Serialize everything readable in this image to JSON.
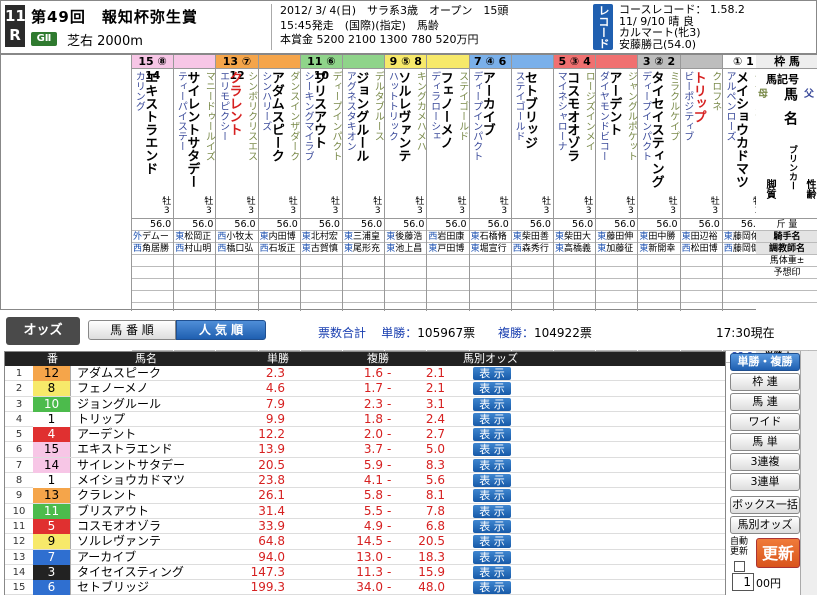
{
  "header": {
    "race_no": "11",
    "race_unit": "R",
    "title": "第49回　報知杯弥生賞",
    "grade": "GⅡ",
    "course": "芝右 2000m",
    "info_line1": "2012/ 3/ 4(日)　サラ系3歳　オープン　15頭",
    "info_line2": "15:45発走　(国際)(指定)　馬齢",
    "info_line3": "本賞金 5200 2100 1300 780 520万円",
    "record_tag": "レコード",
    "record_line1": "コースレコード： 1.58.2",
    "record_line2": "11/ 9/10 晴 良",
    "record_line3": "カルマート(牝3)",
    "record_line4": "安藤勝己(54.0)"
  },
  "card_labels": {
    "waku": "枠 馬",
    "ukigo": "馬記号",
    "bamei": "馬名",
    "haha": "母",
    "chichi": "父",
    "blinker": "ブリンカー",
    "kyakushitsu": "脚質",
    "seirei": "性齢",
    "kinryo": "斤 量",
    "jockey": "騎手名",
    "trainer": "調教師名",
    "weight": "馬体重±",
    "yoso": "予想印",
    "dm": "対戦型DM",
    "odds": "単勝オッズ"
  },
  "horses": [
    {
      "gate": "15 ⑧ 14",
      "gcolor": "#f7c6e6",
      "name": "エキストラエンド",
      "red": false,
      "sire": "カリング",
      "dam": "",
      "sex": "牡3",
      "kin": "56.0",
      "jockey_pref": "外",
      "jockey": "デムー",
      "trainer_pref": "西",
      "trainer": "角居勝",
      "dm": "67.6",
      "dmbg": "#f5d6a0",
      "odds": "13.9"
    },
    {
      "gate": "",
      "gcolor": "#f7c6e6",
      "name": "サイレントサタデー",
      "red": false,
      "sire": "ティーパイステー",
      "dam": "マニードゥールイズ",
      "sex": "牡3",
      "kin": "56.0",
      "jockey_pref": "東",
      "jockey": "松岡正",
      "trainer_pref": "西",
      "trainer": "村山明",
      "dm": "50.4",
      "dmbg": "#fff",
      "odds": "20.5"
    },
    {
      "gate": "13 ⑦ 12",
      "gcolor": "#f5a54a",
      "name": "クラレント",
      "red": true,
      "sire": "エリモピクシー",
      "dam": "シンボリクリスエス",
      "sex": "牡3",
      "kin": "56.0",
      "jockey_pref": "西",
      "jockey": "小牧太",
      "trainer_pref": "西",
      "trainer": "橋口弘",
      "dm": "65.4",
      "dmbg": "#bfe8a8",
      "odds": "26.1"
    },
    {
      "gate": "",
      "gcolor": "#f5a54a",
      "name": "アダムスピーク",
      "red": false,
      "sire": "シンハリーズ",
      "dam": "ダンスインザダーク",
      "sex": "牡3",
      "kin": "56.0",
      "jockey_pref": "東",
      "jockey": "内田博",
      "trainer_pref": "西",
      "trainer": "石坂正",
      "dm": "63.9",
      "dmbg": "#e6a8e6",
      "odds": "2.3"
    },
    {
      "gate": "11 ⑥ 10",
      "gcolor": "#8fd48a",
      "name": "ブリスアウト",
      "red": false,
      "sire": "シーキングマイラブ",
      "dam": "ディープインパクト",
      "sex": "牡3",
      "kin": "56.0",
      "jockey_pref": "東",
      "jockey": "北村宏",
      "trainer_pref": "東",
      "trainer": "古賀慎",
      "dm": "34.7",
      "dmbg": "#fff",
      "odds": "31.4"
    },
    {
      "gate": "",
      "gcolor": "#8fd48a",
      "name": "ジョングルール",
      "red": false,
      "sire": "アグネスタキオン",
      "dam": "デルタブルース",
      "sex": "牡3",
      "kin": "56.0",
      "jockey_pref": "東",
      "jockey": "三浦皇",
      "trainer_pref": "東",
      "trainer": "尾形充",
      "dm": "63.8",
      "dmbg": "#fff",
      "odds": "7.9"
    },
    {
      "gate": "9 ⑤ 8",
      "gcolor": "#f7e96a",
      "name": "ソルレヴァンテ",
      "red": false,
      "sire": "ハットトリック",
      "dam": "キングカメハメハ",
      "sex": "牡3",
      "kin": "56.0",
      "jockey_pref": "東",
      "jockey": "後藤浩",
      "trainer_pref": "東",
      "trainer": "池上昌",
      "dm": "17.7",
      "dmbg": "#fff",
      "odds": "64.8"
    },
    {
      "gate": "",
      "gcolor": "#f7e96a",
      "name": "フェノーメノ",
      "red": false,
      "sire": "ディラローシェ",
      "dam": "ステイゴールド",
      "sex": "牡3",
      "kin": "56.0",
      "jockey_pref": "西",
      "jockey": "岩田康",
      "trainer_pref": "東",
      "trainer": "戸田博",
      "dm": "62.2",
      "dmbg": "#fff",
      "odds": "4.6"
    },
    {
      "gate": "7 ④ 6",
      "gcolor": "#7ab0ea",
      "name": "アーカイブ",
      "red": false,
      "sire": "ディープインパクト",
      "dam": "",
      "sex": "牡3",
      "kin": "56.0",
      "jockey_pref": "東",
      "jockey": "石橋脩",
      "trainer_pref": "東",
      "trainer": "堀宣行",
      "dm": "54.2",
      "dmbg": "#fff",
      "odds": "94.0"
    },
    {
      "gate": "",
      "gcolor": "#7ab0ea",
      "name": "セトブリッジ",
      "red": false,
      "sire": "ステイゴールド",
      "dam": "",
      "sex": "牡3",
      "kin": "56.0",
      "jockey_pref": "東",
      "jockey": "柴田善",
      "trainer_pref": "西",
      "trainer": "森秀行",
      "dm": "21.9",
      "dmbg": "#fff",
      "odds": "199.3"
    },
    {
      "gate": "5 ③ 4",
      "gcolor": "#f07070",
      "name": "コスモオオゾラ",
      "red": false,
      "sire": "マイネシャローナ",
      "dam": "ロージズインメイ",
      "sex": "牡3",
      "kin": "56.0",
      "jockey_pref": "東",
      "jockey": "柴田大",
      "trainer_pref": "東",
      "trainer": "高橋義",
      "dm": "41.3",
      "dmbg": "#fff",
      "odds": "33.9"
    },
    {
      "gate": "",
      "gcolor": "#f07070",
      "name": "アーデント",
      "red": false,
      "sire": "ダイヤモンドビコー",
      "dam": "ジャングルポケット",
      "sex": "牡3",
      "kin": "56.0",
      "jockey_pref": "東",
      "jockey": "藤田伸",
      "trainer_pref": "東",
      "trainer": "加藤征",
      "dm": "59.0",
      "dmbg": "#fff",
      "odds": "12.2"
    },
    {
      "gate": "3 ② 2",
      "gcolor": "#bdbdbd",
      "name": "タイセイスティング",
      "red": false,
      "sire": "ディープインパクト",
      "dam": "ミラクルケイプ",
      "sex": "牡3",
      "kin": "56.0",
      "jockey_pref": "東",
      "jockey": "田中勝",
      "trainer_pref": "東",
      "trainer": "新開幸",
      "dm": "",
      "dmbg": "#fff",
      "odds": "147.3"
    },
    {
      "gate": "",
      "gcolor": "#bdbdbd",
      "name": "トリップ",
      "red": true,
      "sire": "ビーポジティブ",
      "dam": "クロフネ",
      "sex": "牡3",
      "kin": "56.0",
      "jockey_pref": "東",
      "jockey": "田辺裕",
      "trainer_pref": "西",
      "trainer": "松田博",
      "dm": "70.2",
      "dmbg": "#f7b7c9",
      "odds": "9.9"
    },
    {
      "gate": "① 1",
      "gcolor": "#fff",
      "name": "メイショウカドマツ",
      "red": false,
      "sire": "アルペンローズ",
      "dam": "ダイワメジャー",
      "sex": "牡3",
      "kin": "56.0",
      "jockey_pref": "東",
      "jockey": "藤岡佑",
      "trainer_pref": "西",
      "trainer": "藤岡健",
      "dm": "51.7",
      "dmbg": "#fff",
      "odds": "23.8"
    }
  ],
  "oddsbar": {
    "title": "オッズ",
    "tab_umaban": "馬 番 順",
    "tab_ninki": "人 気 順",
    "votes_label": "票数合計",
    "win_label": "単勝：",
    "win_votes": "105967票",
    "place_label": "複勝：",
    "place_votes": "104922票",
    "now": "17:30現在"
  },
  "table": {
    "headers": {
      "rank": "",
      "num": "番",
      "name": "馬名",
      "win": "単勝",
      "place": "複勝",
      "horse_odds": "馬別オッズ"
    },
    "button_label": "表 示",
    "rows": [
      {
        "rank": "1",
        "num": "12",
        "bg": "#f5a54a",
        "fg": "#000",
        "name": "アダムスピーク",
        "win": "2.3",
        "pmin": "1.6",
        "pmax": "2.1"
      },
      {
        "rank": "2",
        "num": "8",
        "bg": "#f7e96a",
        "fg": "#000",
        "name": "フェノーメノ",
        "win": "4.6",
        "pmin": "1.7",
        "pmax": "2.1"
      },
      {
        "rank": "3",
        "num": "10",
        "bg": "#4cbb4c",
        "fg": "#fff",
        "name": "ジョングルール",
        "win": "7.9",
        "pmin": "2.3",
        "pmax": "3.1"
      },
      {
        "rank": "4",
        "num": "1",
        "bg": "#fff",
        "fg": "#000",
        "name": "トリップ",
        "win": "9.9",
        "pmin": "1.8",
        "pmax": "2.4"
      },
      {
        "rank": "5",
        "num": "4",
        "bg": "#e03030",
        "fg": "#fff",
        "name": "アーデント",
        "win": "12.2",
        "pmin": "2.0",
        "pmax": "2.7"
      },
      {
        "rank": "6",
        "num": "15",
        "bg": "#f7c6e6",
        "fg": "#000",
        "name": "エキストラエンド",
        "win": "13.9",
        "pmin": "3.7",
        "pmax": "5.0"
      },
      {
        "rank": "7",
        "num": "14",
        "bg": "#f7c6e6",
        "fg": "#000",
        "name": "サイレントサタデー",
        "win": "20.5",
        "pmin": "5.9",
        "pmax": "8.3"
      },
      {
        "rank": "8",
        "num": "1",
        "bg": "#fff",
        "fg": "#000",
        "name": "メイショウカドマツ",
        "win": "23.8",
        "pmin": "4.1",
        "pmax": "5.6"
      },
      {
        "rank": "9",
        "num": "13",
        "bg": "#f5a54a",
        "fg": "#000",
        "name": "クラレント",
        "win": "26.1",
        "pmin": "5.8",
        "pmax": "8.1"
      },
      {
        "rank": "10",
        "num": "11",
        "bg": "#4cbb4c",
        "fg": "#fff",
        "name": "ブリスアウト",
        "win": "31.4",
        "pmin": "5.5",
        "pmax": "7.8"
      },
      {
        "rank": "11",
        "num": "5",
        "bg": "#e03030",
        "fg": "#fff",
        "name": "コスモオオゾラ",
        "win": "33.9",
        "pmin": "4.9",
        "pmax": "6.8"
      },
      {
        "rank": "12",
        "num": "9",
        "bg": "#f7e96a",
        "fg": "#000",
        "name": "ソルレヴァンテ",
        "win": "64.8",
        "pmin": "14.5",
        "pmax": "20.5"
      },
      {
        "rank": "13",
        "num": "7",
        "bg": "#2f6fd0",
        "fg": "#fff",
        "name": "アーカイブ",
        "win": "94.0",
        "pmin": "13.0",
        "pmax": "18.3"
      },
      {
        "rank": "14",
        "num": "3",
        "bg": "#222",
        "fg": "#fff",
        "name": "タイセイスティング",
        "win": "147.3",
        "pmin": "11.3",
        "pmax": "15.9"
      },
      {
        "rank": "15",
        "num": "6",
        "bg": "#2f6fd0",
        "fg": "#fff",
        "name": "セトブリッジ",
        "win": "199.3",
        "pmin": "34.0",
        "pmax": "48.0"
      }
    ]
  },
  "side": {
    "btn_tanfuku": "単勝・複勝",
    "btn_wakuren": "枠 連",
    "btn_umaren": "馬 連",
    "btn_wide": "ワイド",
    "btn_umatan": "馬 単",
    "btn_3renpuku": "3連複",
    "btn_3rentan": "3連単",
    "btn_box": "ボックス一括",
    "btn_horse_odds": "馬別オッズ",
    "auto_label": "自動更新",
    "update": "更新",
    "amount": "1",
    "yen": "00円"
  }
}
